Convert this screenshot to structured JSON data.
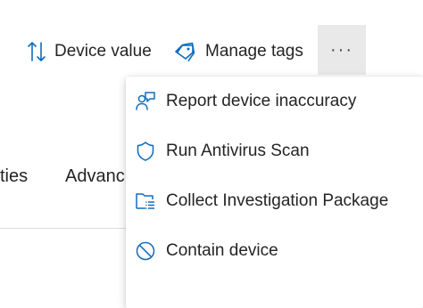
{
  "toolbar": {
    "device_value_label": "Device value",
    "manage_tags_label": "Manage tags",
    "more_label": "···"
  },
  "tabs": [
    {
      "label": "ties"
    },
    {
      "label": "Advanc"
    }
  ],
  "menu": {
    "items": [
      {
        "label": "Report device inaccuracy",
        "icon": "person-feedback-icon"
      },
      {
        "label": "Run Antivirus Scan",
        "icon": "shield-icon"
      },
      {
        "label": "Collect Investigation Package",
        "icon": "folder-list-icon"
      },
      {
        "label": "Contain device",
        "icon": "prohibited-icon"
      }
    ]
  },
  "colors": {
    "accent": "#0f6cbd",
    "text": "#242424",
    "more_button_bg": "#e9e9e9"
  }
}
